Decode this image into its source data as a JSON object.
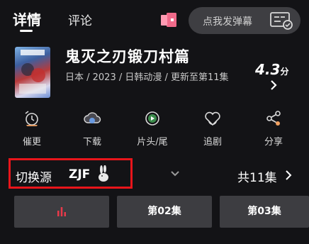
{
  "header": {
    "tab_detail": "详情",
    "tab_comment": "评论",
    "danmaku_placeholder": "点我发弹幕"
  },
  "anime": {
    "title": "鬼灭之刃锻刀村篇",
    "meta": "日本 / 2023 / 日韩动漫 / 更新至第11集",
    "rating_value": "4.3",
    "rating_unit": "分"
  },
  "actions": [
    {
      "label": "催更",
      "icon": "alarm-icon"
    },
    {
      "label": "下载",
      "icon": "download-cloud-icon"
    },
    {
      "label": "片头/尾",
      "icon": "play-skip-icon"
    },
    {
      "label": "追剧",
      "icon": "heart-follow-icon"
    },
    {
      "label": "分享",
      "icon": "share-icon"
    }
  ],
  "source": {
    "label": "切换源",
    "value": "ZJF"
  },
  "episodes": {
    "count_label": "共11集",
    "items": [
      "",
      "第02集",
      "第03集"
    ]
  },
  "colors": {
    "highlight_box": "#e8151b",
    "playing_bars": "#e8394a",
    "accent_pink": "#f06a8a"
  }
}
